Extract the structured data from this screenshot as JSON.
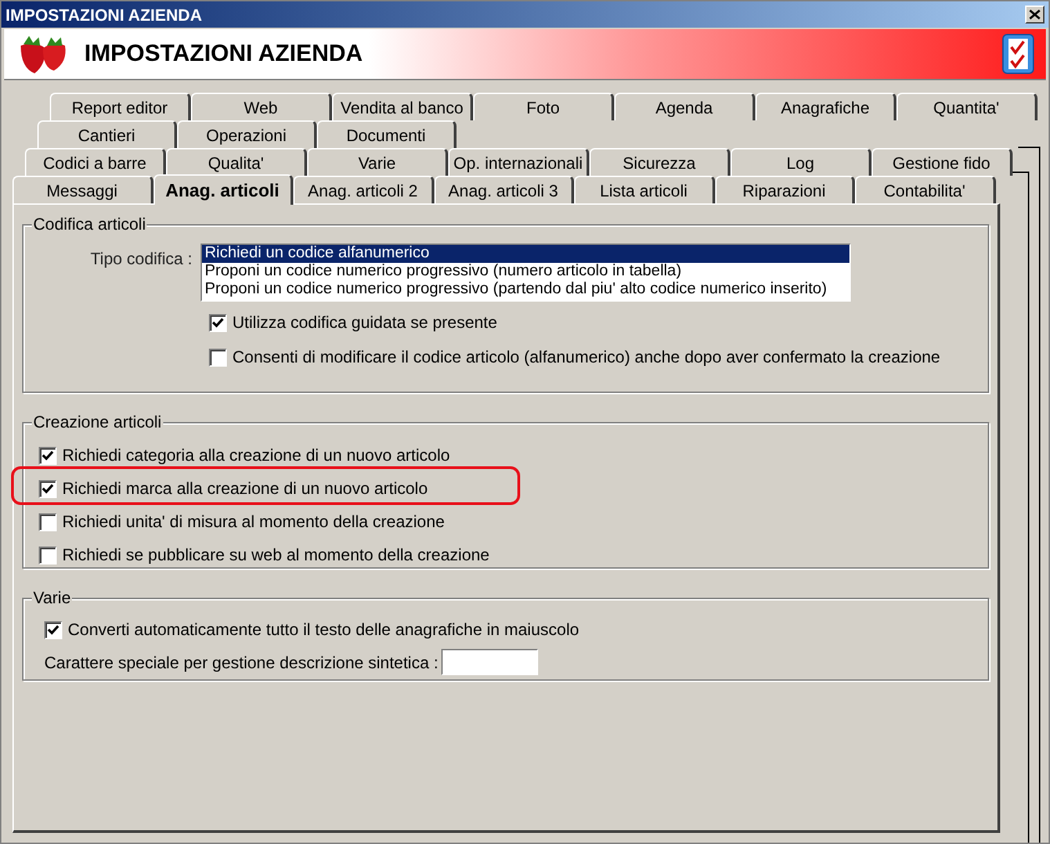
{
  "window": {
    "title": "IMPOSTAZIONI AZIENDA"
  },
  "header": {
    "title": "IMPOSTAZIONI AZIENDA"
  },
  "tab_rows": [
    [
      {
        "label": "Report editor",
        "selected": false
      },
      {
        "label": "Web",
        "selected": false
      },
      {
        "label": "Vendita al banco",
        "selected": false
      },
      {
        "label": "Foto",
        "selected": false
      },
      {
        "label": "Agenda",
        "selected": false
      },
      {
        "label": "Anagrafiche",
        "selected": false
      },
      {
        "label": "Quantita'",
        "selected": false
      }
    ],
    [
      {
        "label": "Cantieri",
        "selected": false
      },
      {
        "label": "Operazioni",
        "selected": false
      },
      {
        "label": "Documenti",
        "selected": false
      }
    ],
    [
      {
        "label": "Codici a barre",
        "selected": false
      },
      {
        "label": "Qualita'",
        "selected": false
      },
      {
        "label": "Varie",
        "selected": false
      },
      {
        "label": "Op. internazionali",
        "selected": false
      },
      {
        "label": "Sicurezza",
        "selected": false
      },
      {
        "label": "Log",
        "selected": false
      },
      {
        "label": "Gestione fido",
        "selected": false
      }
    ],
    [
      {
        "label": "Messaggi",
        "selected": false
      },
      {
        "label": "Anag. articoli",
        "selected": true
      },
      {
        "label": "Anag. articoli 2",
        "selected": false
      },
      {
        "label": "Anag. articoli 3",
        "selected": false
      },
      {
        "label": "Lista articoli",
        "selected": false
      },
      {
        "label": "Riparazioni",
        "selected": false
      },
      {
        "label": "Contabilita'",
        "selected": false
      }
    ]
  ],
  "codifica": {
    "title": "Codifica articoli",
    "label": "Tipo codifica :",
    "options": [
      {
        "label": "Richiedi un codice alfanumerico",
        "selected": true
      },
      {
        "label": "Proponi un codice numerico progressivo (numero articolo in tabella)",
        "selected": false
      },
      {
        "label": "Proponi un codice numerico progressivo (partendo dal piu' alto codice numerico inserito)",
        "selected": false
      }
    ],
    "checkboxes": [
      {
        "label": "Utilizza codifica guidata se presente",
        "checked": true
      },
      {
        "label": "Consenti di modificare il codice articolo (alfanumerico) anche dopo aver confermato la creazione",
        "checked": false
      }
    ]
  },
  "creazione": {
    "title": "Creazione articoli",
    "checkboxes": [
      {
        "label": "Richiedi categoria alla creazione di un nuovo articolo",
        "checked": true,
        "highlighted": false
      },
      {
        "label": "Richiedi marca alla creazione di un nuovo articolo",
        "checked": true,
        "highlighted": true
      },
      {
        "label": "Richiedi unita' di misura al momento della creazione",
        "checked": false,
        "highlighted": false
      },
      {
        "label": "Richiedi se pubblicare su web al momento della creazione",
        "checked": false,
        "highlighted": false
      }
    ]
  },
  "varie": {
    "title": "Varie",
    "checkboxes": [
      {
        "label": "Converti automaticamente tutto il testo delle anagrafiche in maiuscolo",
        "checked": true
      }
    ],
    "field": {
      "label": "Carattere speciale per gestione descrizione sintetica :"
    }
  }
}
